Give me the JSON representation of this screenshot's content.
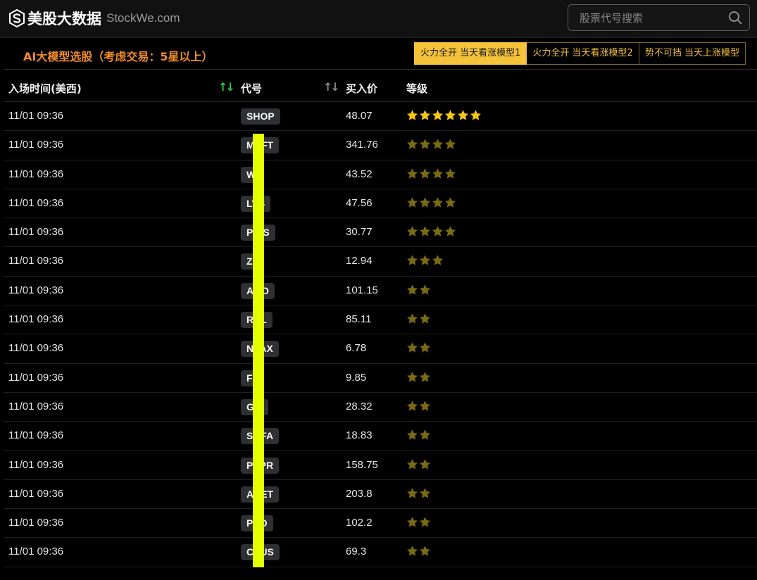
{
  "header": {
    "site_name": "美股大数据",
    "site_domain": "StockWe.com",
    "search_placeholder": "股票代号搜索"
  },
  "panel": {
    "title": "AI大模型选股（考虑交易：5星以上）",
    "tabs": [
      {
        "label": "火力全开 当天看涨模型1",
        "active": true
      },
      {
        "label": "火力全开 当天看涨模型2",
        "active": false
      },
      {
        "label": "势不可挡 当天上涨模型",
        "active": false
      }
    ]
  },
  "table": {
    "columns": {
      "time": "入场时间(美西)",
      "ticker": "代号",
      "price": "买入价",
      "grade": "等级"
    },
    "star_colors": {
      "top": "#f5c518",
      "normal": "#7a6a10"
    },
    "rows": [
      {
        "time": "11/01 09:36",
        "ticker": "SHOP",
        "price": "48.07",
        "stars": 6
      },
      {
        "time": "11/01 09:36",
        "ticker": "MSFT",
        "price": "341.76",
        "stars": 4
      },
      {
        "time": "11/01 09:36",
        "ticker": "W",
        "price": "43.52",
        "stars": 4
      },
      {
        "time": "11/01 09:36",
        "ticker": "LVS",
        "price": "47.56",
        "stars": 4
      },
      {
        "time": "11/01 09:36",
        "ticker": "PINS",
        "price": "30.77",
        "stars": 4
      },
      {
        "time": "11/01 09:36",
        "ticker": "Z",
        "price": "12.94",
        "stars": 3
      },
      {
        "time": "11/01 09:36",
        "ticker": "AMD",
        "price": "101.15",
        "stars": 2
      },
      {
        "time": "11/01 09:36",
        "ticker": "RCL",
        "price": "85.11",
        "stars": 2
      },
      {
        "time": "11/01 09:36",
        "ticker": "NVAX",
        "price": "6.78",
        "stars": 2
      },
      {
        "time": "11/01 09:36",
        "ticker": "F",
        "price": "9.85",
        "stars": 2
      },
      {
        "time": "11/01 09:36",
        "ticker": "GM",
        "price": "28.32",
        "stars": 2
      },
      {
        "time": "11/01 09:36",
        "ticker": "SOFA",
        "price": "18.83",
        "stars": 2
      },
      {
        "time": "11/01 09:36",
        "ticker": "PYPR",
        "price": "158.75",
        "stars": 2
      },
      {
        "time": "11/01 09:36",
        "ticker": "ANET",
        "price": "203.8",
        "stars": 2
      },
      {
        "time": "11/01 09:36",
        "ticker": "PDD",
        "price": "102.2",
        "stars": 2
      },
      {
        "time": "11/01 09:36",
        "ticker": "CSUS",
        "price": "69.3",
        "stars": 2
      }
    ]
  }
}
